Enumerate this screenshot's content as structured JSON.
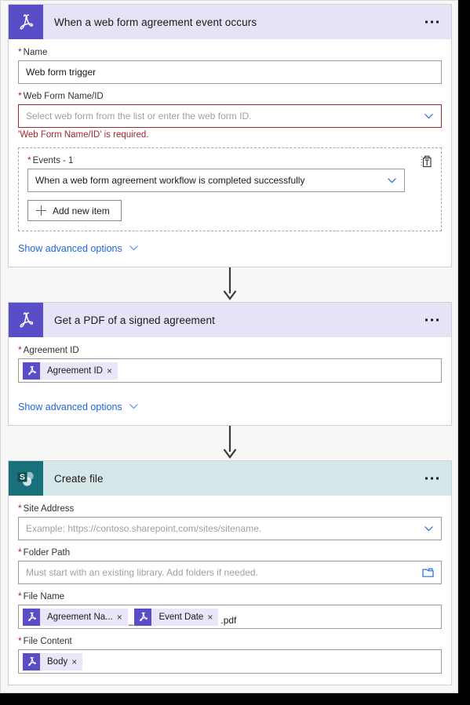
{
  "flow": {
    "cards": [
      {
        "id": "trigger",
        "brand": "adobe",
        "icon_name": "adobe-acrobat-sign-icon",
        "title": "When a web form agreement event occurs",
        "menu_label": "•••",
        "fields": {
          "name": {
            "label": "Name",
            "required": true,
            "value": "Web form trigger",
            "placeholder": ""
          },
          "web_form": {
            "label": "Web Form Name/ID",
            "required": true,
            "value": "",
            "placeholder": "Select web form from the list or enter the web form ID.",
            "error": "'Web Form Name/ID' is required."
          },
          "events": {
            "label": "Events - 1",
            "required": true,
            "value": "When a web form agreement workflow is completed successfully",
            "add_button": "Add new item",
            "delete_icon_name": "delete-item-icon"
          }
        },
        "advanced_link": "Show advanced options"
      },
      {
        "id": "get_pdf",
        "brand": "adobe",
        "icon_name": "adobe-acrobat-sign-icon",
        "title": "Get a PDF of a signed agreement",
        "menu_label": "•••",
        "fields": {
          "agreement_id": {
            "label": "Agreement ID",
            "required": true,
            "tokens": [
              {
                "label": "Agreement ID",
                "remove": "×",
                "icon_name": "adobe-token-icon"
              }
            ]
          }
        },
        "advanced_link": "Show advanced options"
      },
      {
        "id": "create_file",
        "brand": "sharepoint",
        "icon_name": "sharepoint-icon",
        "title": "Create file",
        "menu_label": "•••",
        "fields": {
          "site_address": {
            "label": "Site Address",
            "required": true,
            "value": "",
            "placeholder": "Example: https://contoso.sharepoint.com/sites/sitename."
          },
          "folder_path": {
            "label": "Folder Path",
            "required": true,
            "value": "",
            "placeholder": "Must start with an existing library. Add folders if needed."
          },
          "file_name": {
            "label": "File Name",
            "required": true,
            "tokens": [
              {
                "label": "Agreement Na...",
                "remove": "×",
                "icon_name": "adobe-token-icon"
              },
              {
                "label": "Event Date",
                "remove": "×",
                "icon_name": "adobe-token-icon"
              }
            ],
            "separator": "_",
            "suffix": ".pdf"
          },
          "file_content": {
            "label": "File Content",
            "required": true,
            "tokens": [
              {
                "label": "Body",
                "remove": "×",
                "icon_name": "adobe-token-icon"
              }
            ]
          }
        }
      }
    ],
    "required_marker": "*",
    "connector_icon_name": "down-arrow-connector"
  },
  "colors": {
    "adobe_purple": "#5a4ec8",
    "adobe_header": "#e5e3f6",
    "sharepoint_teal": "#17707a",
    "sharepoint_header": "#d5e7e8",
    "error_red": "#a4262c",
    "link_blue": "#2266dd",
    "token_chip_bg": "#e8e6f8"
  }
}
